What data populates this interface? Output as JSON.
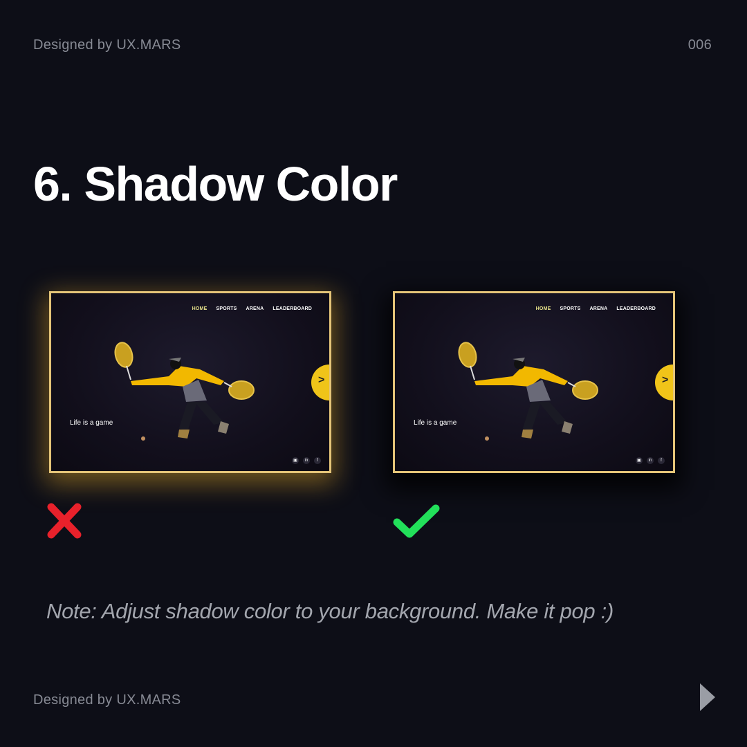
{
  "header": {
    "credit": "Designed by UX.MARS",
    "page_number": "006"
  },
  "title": "6. Shadow Color",
  "examples": [
    {
      "verdict": "wrong",
      "icon": "cross-icon",
      "shadow_color": "#e6aa28"
    },
    {
      "verdict": "right",
      "icon": "check-icon",
      "shadow_color": "#000000"
    }
  ],
  "mockup": {
    "nav": [
      "HOME",
      "SPORTS",
      "ARENA",
      "LEADERBOARD"
    ],
    "tagline": "Life is a game",
    "next_icon": "chevron-right-icon",
    "social": [
      "youtube-icon",
      "linkedin-icon",
      "facebook-icon"
    ],
    "social_labels": [
      "▣",
      "in",
      "f"
    ],
    "next_glyph": ">"
  },
  "colors": {
    "accent": "#f0c419",
    "border": "#e4c478",
    "cross": "#e8212b",
    "check": "#22e05a",
    "background": "#0d0e17"
  },
  "note": "Note: Adjust shadow color to your background. Make it pop :)",
  "footer": {
    "credit": "Designed by UX.MARS",
    "next_icon": "triangle-right-icon"
  }
}
